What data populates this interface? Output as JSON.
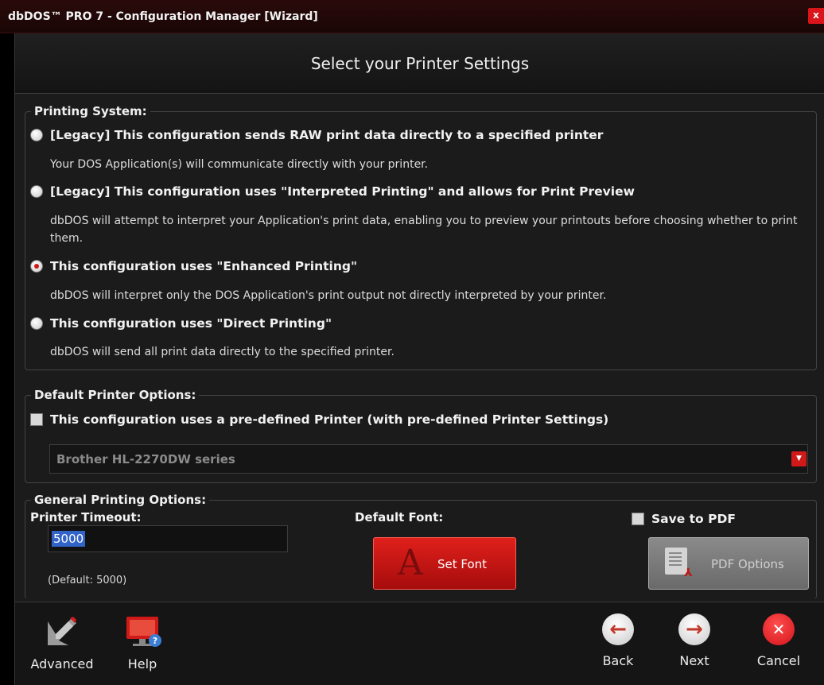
{
  "window": {
    "title": "dbDOS™ PRO 7 - Configuration Manager [Wizard]",
    "close_label": "x"
  },
  "header": {
    "title": "Select your Printer Settings"
  },
  "printing_system": {
    "legend": "Printing System:",
    "options": [
      {
        "label": "[Legacy] This configuration sends RAW print data directly to a specified printer",
        "description": "Your DOS Application(s) will communicate directly with your printer.",
        "selected": false
      },
      {
        "label": "[Legacy] This configuration uses \"Interpreted Printing\" and allows for Print Preview",
        "description": "dbDOS will attempt to interpret your Application's print data, enabling you to preview your printouts before choosing whether to print them.",
        "selected": false
      },
      {
        "label": "This configuration uses \"Enhanced Printing\"",
        "description": "dbDOS will interpret only the DOS Application's print output not directly interpreted by your printer.",
        "selected": true
      },
      {
        "label": "This configuration uses \"Direct Printing\"",
        "description": "dbDOS will send all print data directly to the specified printer.",
        "selected": false
      }
    ]
  },
  "default_printer": {
    "legend": "Default Printer Options:",
    "checkbox_label": "This configuration uses a pre-defined Printer (with pre-defined Printer Settings)",
    "checked": false,
    "printer_select": "Brother HL-2270DW series"
  },
  "general": {
    "legend": "General Printing Options:",
    "timeout_label": "Printer Timeout:",
    "timeout_value": "5000",
    "timeout_default": "(Default: 5000)",
    "font_label": "Default Font:",
    "set_font_button": "Set Font",
    "save_pdf_label": "Save to PDF",
    "save_pdf_checked": false,
    "pdf_options_button": "PDF Options"
  },
  "footer": {
    "advanced": "Advanced",
    "help": "Help",
    "back": "Back",
    "next": "Next",
    "cancel": "Cancel"
  },
  "colors": {
    "accent_red": "#d01a1a",
    "background": "#1b1b1b",
    "selection_blue": "#3264c8"
  },
  "icons": [
    "close-icon",
    "chevron-down-icon",
    "font-icon",
    "pdf-icon",
    "pencil-icon",
    "monitor-help-icon",
    "arrow-left-icon",
    "arrow-right-icon",
    "close-circle-icon"
  ]
}
